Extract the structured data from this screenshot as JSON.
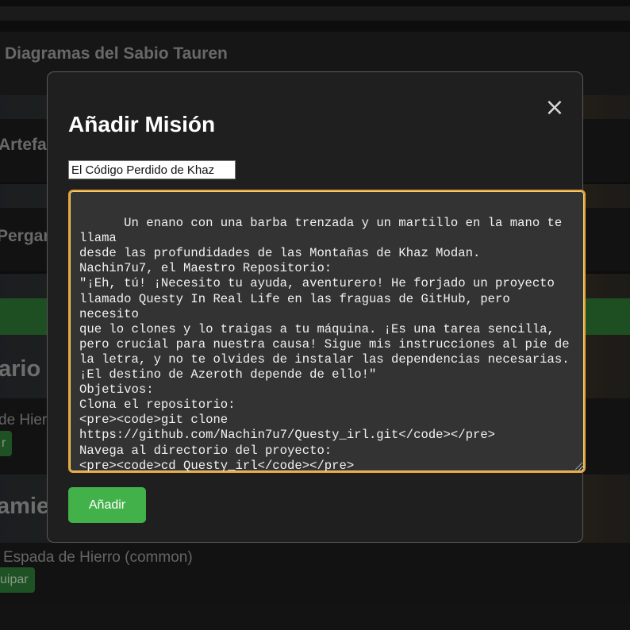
{
  "background": {
    "section_heading": "Diagramas del Sabio Tauren",
    "partial_heading_artefactos": "Artefac",
    "partial_heading_pergaminos": "Pergan",
    "partial_heading_inventario": "ario",
    "partial_item_text": "de Hierr",
    "partial_button_equipar": "r",
    "partial_heading_armamento": "amie",
    "item_text": "Espada de Hierro (common)",
    "partial_button_equipar_2": "uipar"
  },
  "modal": {
    "title": "Añadir Misión",
    "close_label": "×",
    "title_input_value": "El Código Perdido de Khaz",
    "description_value": "Un enano con una barba trenzada y un martillo en la mano te llama\ndesde las profundidades de las Montañas de Khaz Modan.\nNachin7u7, el Maestro Repositorio:\n\"¡Eh, tú! ¡Necesito tu ayuda, aventurero! He forjado un proyecto\nllamado Questy In Real Life en las fraguas de GitHub, pero necesito\nque lo clones y lo traigas a tu máquina. ¡Es una tarea sencilla,\npero crucial para nuestra causa! Sigue mis instrucciones al pie de\nla letra, y no te olvides de instalar las dependencias necesarias.\n¡El destino de Azeroth depende de ello!\"\nObjetivos:\nClona el repositorio:\n<pre><code>git clone\nhttps://github.com/Nachin7u7/Questy_irl.git</code></pre>\nNavega al directorio del proyecto:\n<pre><code>cd Questy_irl</code></pre>\nInstala las dependencias:\n<pre><code>npm install</code></pre>",
    "submit_label": "Añadir"
  },
  "colors": {
    "accent_green": "#43b14a",
    "focus_border": "#e8a33a",
    "modal_bg": "#1f1f1f",
    "textarea_bg": "#333333"
  }
}
